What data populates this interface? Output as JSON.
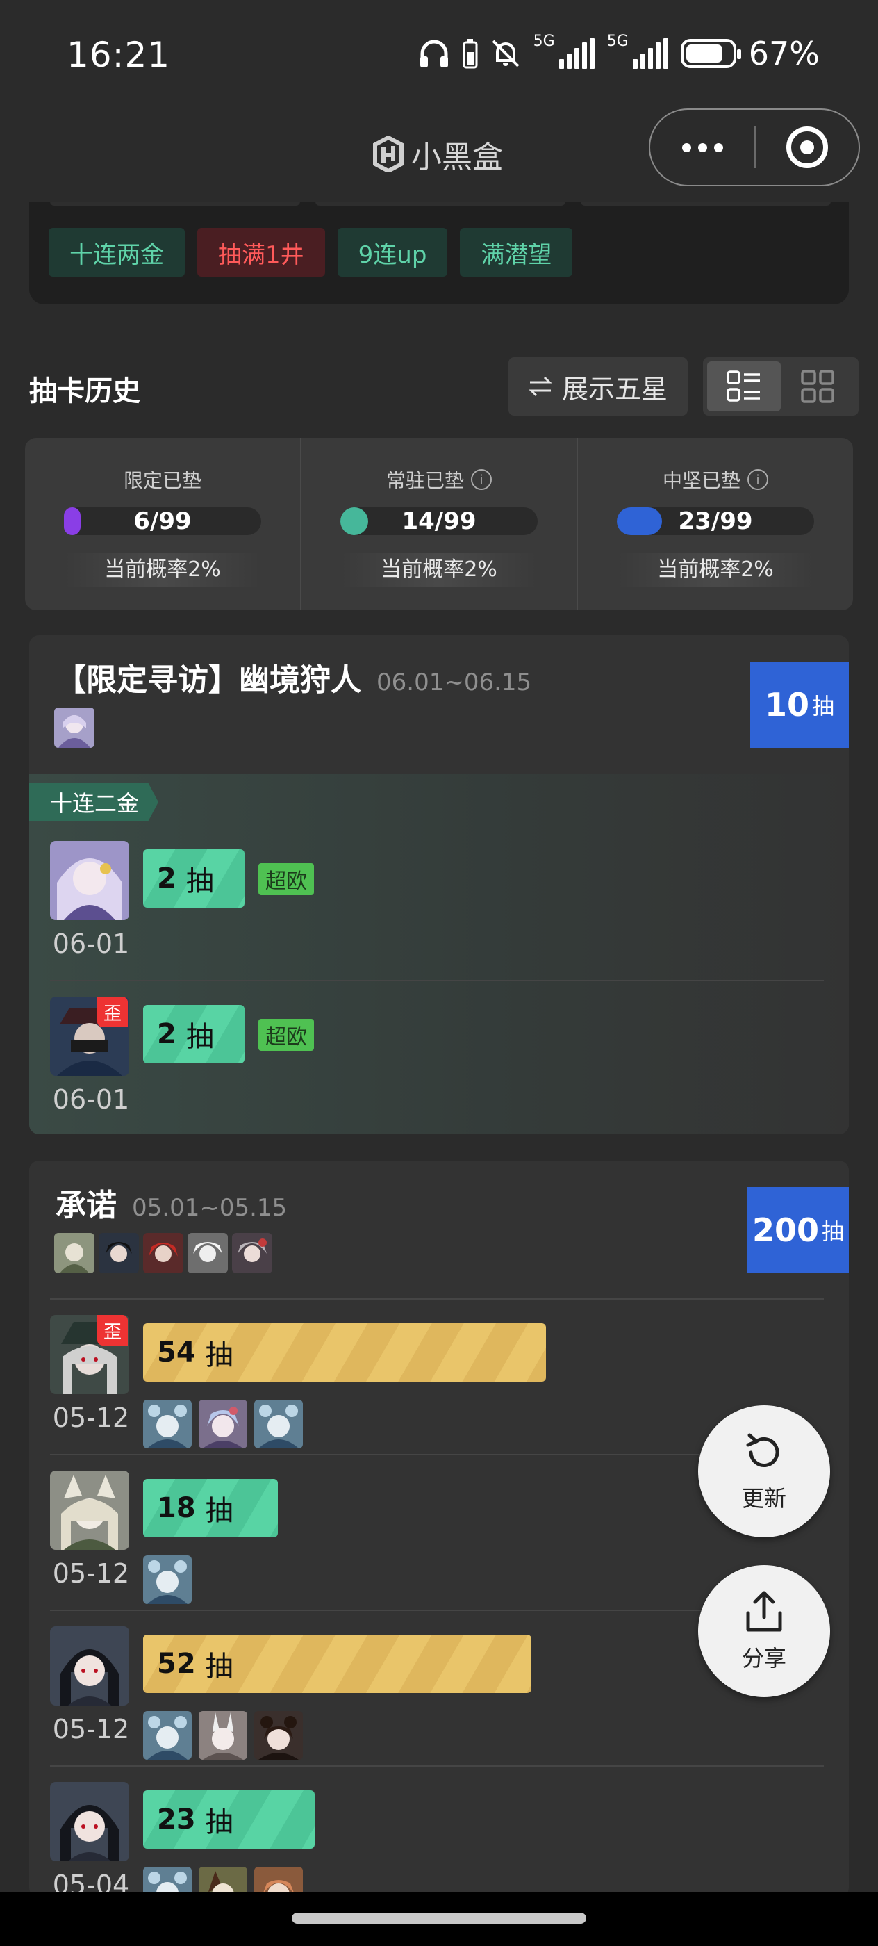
{
  "status_bar": {
    "time": "16:21",
    "network_label": "5G",
    "battery": "67%"
  },
  "title_bar": {
    "app_name": "小黑盒"
  },
  "filter_tags": [
    {
      "label": "十连两金",
      "color": "green"
    },
    {
      "label": "抽满1井",
      "color": "red"
    },
    {
      "label": "9连up",
      "color": "green"
    },
    {
      "label": "满潜望",
      "color": "green"
    }
  ],
  "history": {
    "title": "抽卡历史",
    "show_five_star": "展示五星"
  },
  "stats": [
    {
      "label": "限定已垫",
      "value": "6/99",
      "progress": 0.06,
      "color": "#8a3ee6",
      "rate": "当前概率2%",
      "info": false
    },
    {
      "label": "常驻已垫",
      "value": "14/99",
      "progress": 0.14,
      "color": "#46b79a",
      "rate": "当前概率2%",
      "info": true
    },
    {
      "label": "中坚已垫",
      "value": "23/99",
      "progress": 0.23,
      "color": "#2f63d6",
      "rate": "当前概率2%",
      "info": true
    }
  ],
  "pools": [
    {
      "name": "【限定寻访】幽境狩人",
      "dates": "06.01~06.15",
      "count": "10",
      "count_unit": "抽",
      "banner_tag": "十连二金",
      "rows": [
        {
          "date": "06-01",
          "pulls": "2",
          "unit": "抽",
          "badge": "超欧",
          "wai": false,
          "bar": "green"
        },
        {
          "date": "06-01",
          "pulls": "2",
          "unit": "抽",
          "badge": "超欧",
          "wai": true,
          "wai_label": "歪",
          "bar": "green"
        }
      ]
    },
    {
      "name": "承诺",
      "dates": "05.01~05.15",
      "count": "200",
      "count_unit": "抽",
      "rows": [
        {
          "date": "05-12",
          "pulls": "54",
          "unit": "抽",
          "wai": true,
          "wai_label": "歪",
          "bar": "yellow",
          "fill": 0.545
        },
        {
          "date": "05-12",
          "pulls": "18",
          "unit": "抽",
          "wai": false,
          "bar": "green",
          "fill": 0.182
        },
        {
          "date": "05-12",
          "pulls": "52",
          "unit": "抽",
          "wai": false,
          "bar": "yellow",
          "fill": 0.525
        },
        {
          "date": "05-04",
          "pulls": "23",
          "unit": "抽",
          "wai": false,
          "bar": "green",
          "fill": 0.232
        }
      ]
    }
  ],
  "fab": {
    "refresh": "更新",
    "share": "分享"
  }
}
